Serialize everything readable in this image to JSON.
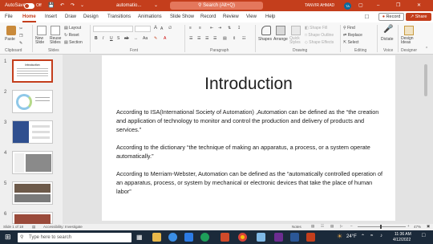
{
  "titlebar": {
    "autosave_label": "AutoSave",
    "toggle_state": "Off",
    "filename": "automatio...",
    "search_placeholder": "Search (Alt+Q)",
    "username": "TANVIR AHMAD",
    "initials": "TA"
  },
  "menu": {
    "tabs": [
      "File",
      "Home",
      "Insert",
      "Draw",
      "Design",
      "Transitions",
      "Animations",
      "Slide Show",
      "Record",
      "Review",
      "View",
      "Help"
    ],
    "active_tab": "Home",
    "record_label": "Record",
    "share_label": "Share"
  },
  "ribbon": {
    "paste_label": "Paste",
    "new_slide_label": "New Slide",
    "reuse_slides_label": "Reuse Slides",
    "layout_label": "Layout",
    "reset_label": "Reset",
    "section_label": "Section",
    "font_size_a": "A",
    "font_size_a2": "A",
    "shapes_label": "Shapes",
    "arrange_label": "Arrange",
    "quick_styles_label": "Quick Styles",
    "shape_fill_label": "Shape Fill",
    "shape_outline_label": "Shape Outline",
    "shape_effects_label": "Shape Effects",
    "find_label": "Find",
    "replace_label": "Replace",
    "select_label": "Select",
    "dictate_label": "Dictate",
    "design_ideas_label": "Design Ideas",
    "groups": [
      "Clipboard",
      "Slides",
      "Font",
      "Paragraph",
      "Drawing",
      "Editing",
      "Voice",
      "Designer"
    ]
  },
  "thumbnails": {
    "numbers": [
      "1",
      "2",
      "3",
      "4",
      "5",
      "6"
    ],
    "thumb1_title": "Introduction"
  },
  "slide": {
    "title": "Introduction",
    "paragraphs": [
      "According to ISA(International Society of Automation) ,Automation can be defined as the “the creation and application of technology to monitor and control the production and delivery of products and services.”",
      "According to the dictionary  “the technique of making an apparatus, a process, or a system operate automatically.”",
      "According to Merriam-Webster, Automation can be defined as the “automatically controlled operation of an apparatus, process, or system by mechanical or electronic devices that take the place of human labor”"
    ]
  },
  "statusbar": {
    "slide_info": "Slide 1 of 18",
    "accessibility": "Accessibility: Investigate",
    "notes_label": "Notes",
    "zoom": "47%"
  },
  "taskbar": {
    "search_placeholder": "Type here to search",
    "temperature": "24°F",
    "time": "11:36 AM",
    "date": "4/12/2022"
  },
  "colors": {
    "accent": "#c43e1c",
    "taskbar": "#1b2a3a"
  }
}
